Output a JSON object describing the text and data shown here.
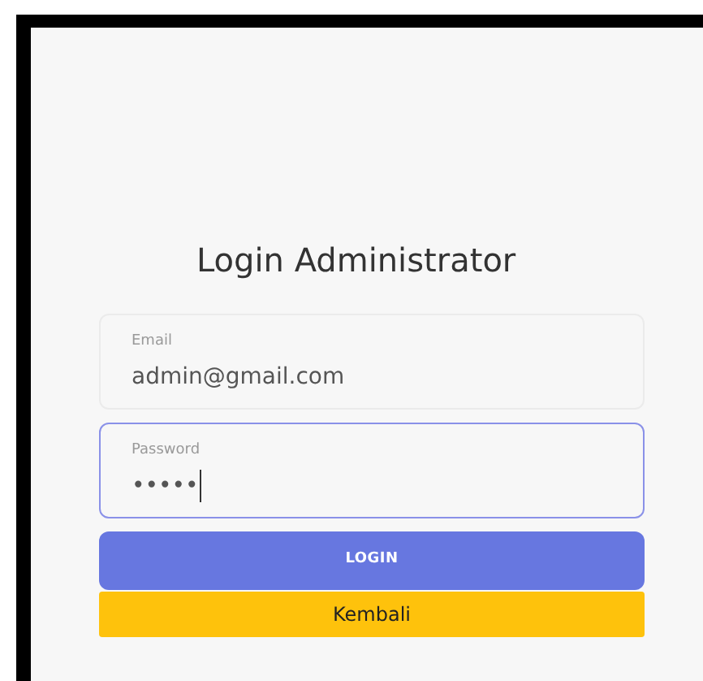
{
  "title": "Login Administrator",
  "fields": [
    {
      "label": "Email",
      "value": "admin@gmail.com",
      "focused": false
    },
    {
      "label": "Password",
      "value": "•••••",
      "focused": true
    }
  ],
  "buttons": [
    {
      "label": "LOGIN",
      "kind": "primary"
    },
    {
      "label": "Kembali",
      "kind": "warning"
    }
  ]
}
